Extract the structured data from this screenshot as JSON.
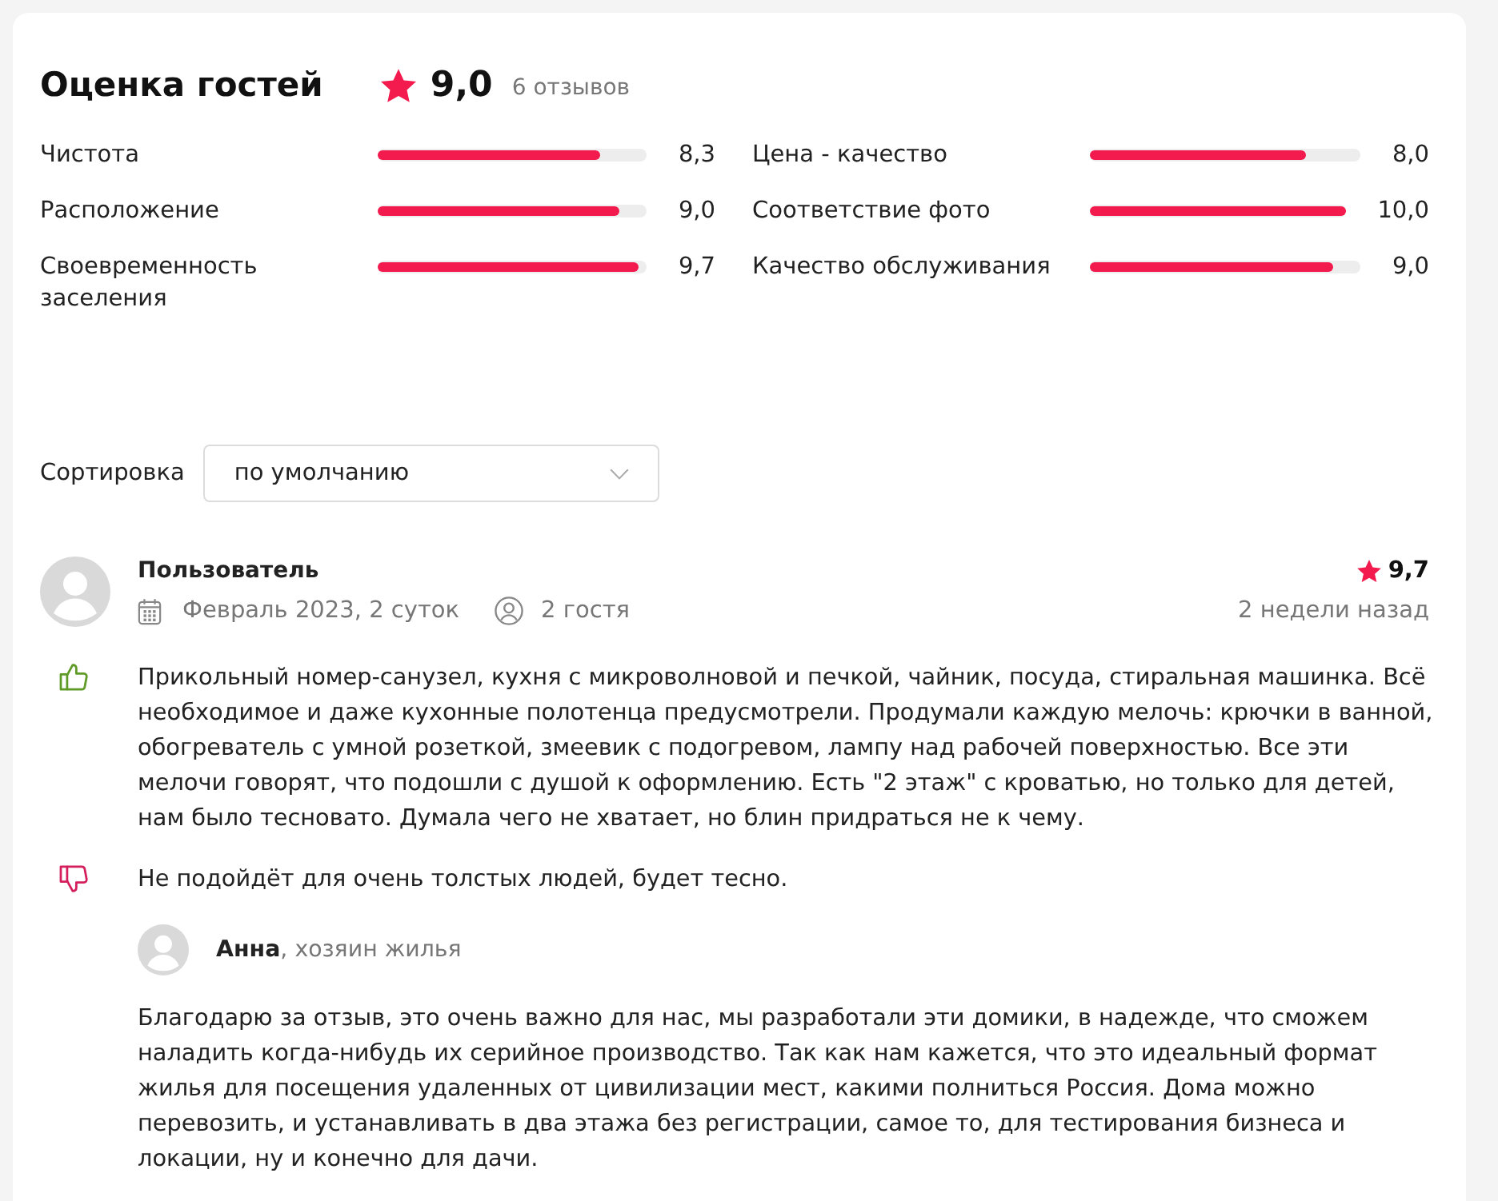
{
  "header": {
    "title": "Оценка гостей",
    "score": "9,0",
    "reviews_count": "6 отзывов"
  },
  "criteria": [
    {
      "label": "Чистота",
      "level": 0.83,
      "score": "8,3"
    },
    {
      "label": "Цена - качество",
      "level": 0.8,
      "score": "8,0"
    },
    {
      "label": "Расположение",
      "level": 0.9,
      "score": "9,0"
    },
    {
      "label": "Соответствие фото",
      "level": 1.0,
      "score": "10,0"
    },
    {
      "label": "Своевременность заселения",
      "level": 0.97,
      "score": "9,7"
    },
    {
      "label": "Качество обслуживания",
      "level": 0.9,
      "score": "9,0"
    }
  ],
  "sort": {
    "label": "Сортировка",
    "value": "по умолчанию"
  },
  "reviews": [
    {
      "author": "Пользователь",
      "stay": "Февраль 2023, 2 суток",
      "guests": "2 гостя",
      "score": "9,7",
      "posted": "2 недели назад",
      "comments": [
        {
          "kind": "pro",
          "text": "Прикольный номер-санузел, кухня с микроволновой и печкой, чайник, посуда, стиральная машинка. Всё необходимое и даже кухонные полотенца предусмотрели. Продумали каждую мелочь: крючки в ванной, обогреватель с умной розеткой, змеевик с подогревом, лампу над рабочей поверхностью. Все эти мелочи говорят, что подошли с душой к оформлению. Есть \"2 этаж\" с кроватью, но только для детей, нам было тесновато. Думала чего не хватает, но блин придраться не к чему."
        },
        {
          "kind": "con",
          "text": "Не подойдёт для очень толстых людей, будет тесно."
        }
      ],
      "reply": {
        "author": "**Анна**, хозяин жилья",
        "text": "Благодарю за отзыв, это очень важно для нас, мы разработали эти домики, в надежде, что сможем наладить когда-нибудь их серийное производство. Так как нам кажется, что это идеальный формат жилья для посещения удаленных от цивилизации мест, какими полниться Россия. Дома можно перевозить, и устанавливать в два этажа без регистрации, самое то, для тестирования бизнеса и локации, ну и конечно для дачи."
      }
    }
  ]
}
